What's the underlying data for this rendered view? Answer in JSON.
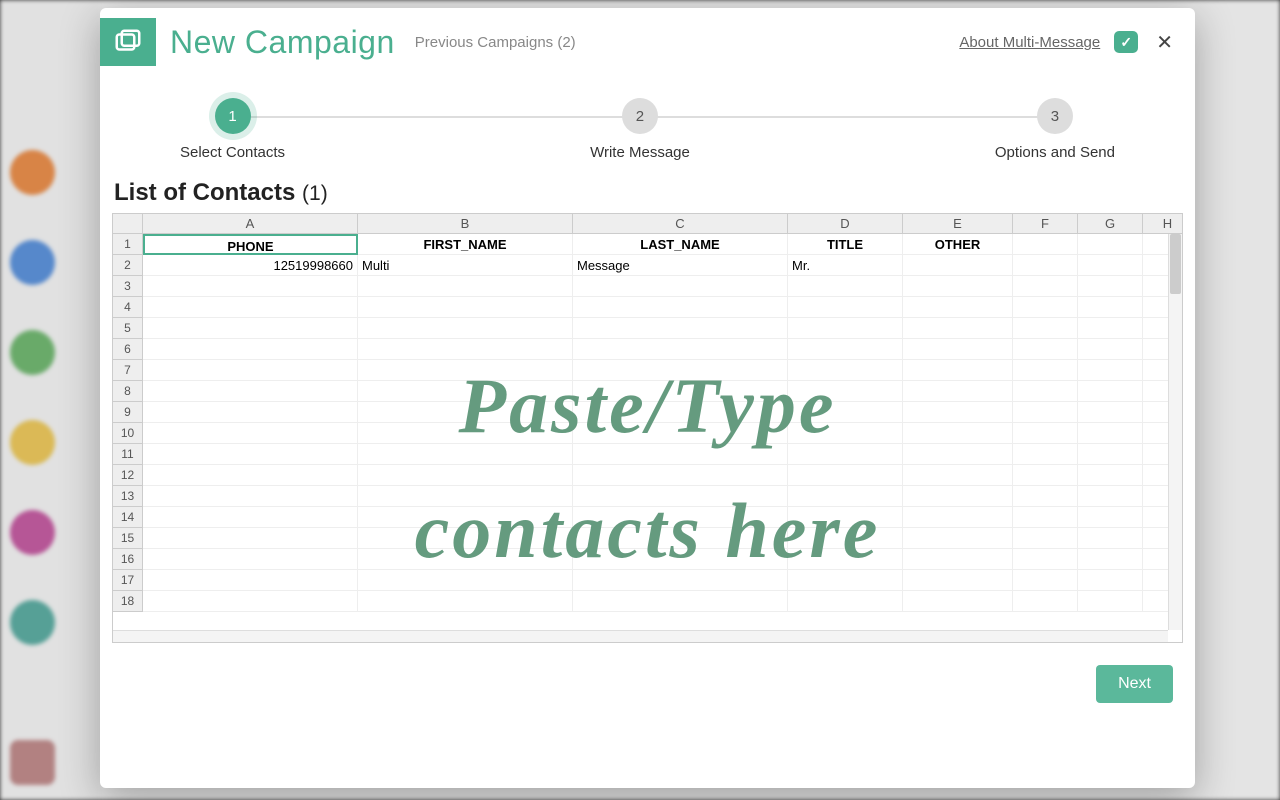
{
  "header": {
    "title": "New Campaign",
    "prev_campaigns_label": "Previous Campaigns (2)",
    "about_label": "About Multi-Message",
    "check_glyph": "✓",
    "close_glyph": "✕"
  },
  "stepper": {
    "steps": [
      {
        "num": "1",
        "label": "Select Contacts",
        "active": true
      },
      {
        "num": "2",
        "label": "Write Message",
        "active": false
      },
      {
        "num": "3",
        "label": "Options and Send",
        "active": false
      }
    ]
  },
  "section": {
    "title": "List of Contacts",
    "count_label": "(1)"
  },
  "sheet": {
    "col_letters": [
      "A",
      "B",
      "C",
      "D",
      "E",
      "F",
      "G",
      "H"
    ],
    "row_nums": [
      "1",
      "2",
      "3",
      "4",
      "5",
      "6",
      "7",
      "8",
      "9",
      "10",
      "11",
      "12",
      "13",
      "14",
      "15",
      "16",
      "17",
      "18"
    ],
    "header_row": [
      "PHONE",
      "FIRST_NAME",
      "LAST_NAME",
      "TITLE",
      "OTHER",
      "",
      "",
      ""
    ],
    "data_rows": [
      [
        "12519998660",
        "Multi",
        "Message",
        "Mr.",
        "",
        "",
        "",
        ""
      ]
    ],
    "overlay_line1": "Paste/Type",
    "overlay_line2": "contacts here"
  },
  "footer": {
    "next_label": "Next"
  },
  "colors": {
    "accent": "#4aaf8f"
  }
}
